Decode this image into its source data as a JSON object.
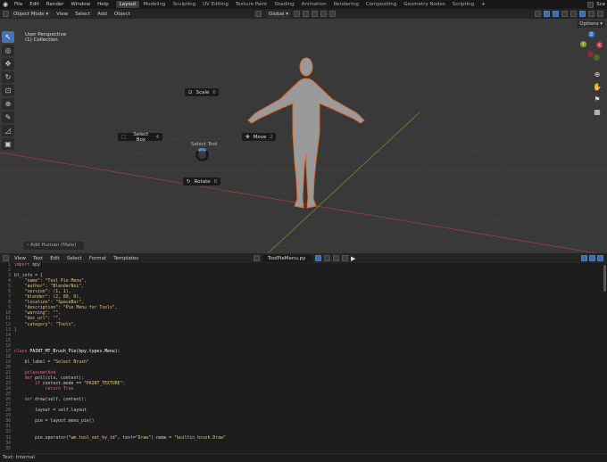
{
  "topbar": {
    "menus": [
      "File",
      "Edit",
      "Render",
      "Window",
      "Help"
    ],
    "workspaces": [
      "Layout",
      "Modeling",
      "Sculpting",
      "UV Editing",
      "Texture Paint",
      "Shading",
      "Animation",
      "Rendering",
      "Compositing",
      "Geometry Nodes",
      "Scripting"
    ],
    "active_workspace": "Layout",
    "add_tab": "+",
    "scene_label": "Sce"
  },
  "viewport_header": {
    "mode": "Object Mode",
    "menus": [
      "View",
      "Select",
      "Add",
      "Object"
    ],
    "transform": "Global",
    "options": "Options"
  },
  "viewport": {
    "title": "User Perspective",
    "collection": "(1) Collection",
    "pie": {
      "title": "Select Tool",
      "scale": {
        "label": "Scale",
        "key": "6"
      },
      "select_box": {
        "label": "Select Box",
        "key": "4"
      },
      "move": {
        "label": "Move",
        "key": "2"
      },
      "rotate": {
        "label": "Rotate",
        "key": "8"
      }
    },
    "operator_panel": "Add Human (Male)",
    "gizmo": {
      "x": "X",
      "y": "Y",
      "z": "Z"
    }
  },
  "editor_header": {
    "menus": [
      "View",
      "Text",
      "Edit",
      "Select",
      "Format",
      "Templates"
    ],
    "filename": "ToolPieMenu.py"
  },
  "code_lines": [
    [
      {
        "t": "import",
        "c": "kw"
      },
      {
        "t": " bpy",
        "c": ""
      }
    ],
    [],
    [
      {
        "t": "bl_info = {",
        "c": ""
      }
    ],
    [
      {
        "t": "    ",
        "c": ""
      },
      {
        "t": "\"name\": \"Tool Pie Menu\",",
        "c": "str"
      }
    ],
    [
      {
        "t": "    ",
        "c": ""
      },
      {
        "t": "\"author\": \"BlenderNoi\",",
        "c": "str"
      }
    ],
    [
      {
        "t": "    ",
        "c": ""
      },
      {
        "t": "\"version\": (1, 1),",
        "c": "str"
      }
    ],
    [
      {
        "t": "    ",
        "c": ""
      },
      {
        "t": "\"blender\": (2, 80, 0),",
        "c": "str"
      }
    ],
    [
      {
        "t": "    ",
        "c": ""
      },
      {
        "t": "\"location\": \"SpaceBar\",",
        "c": "str"
      }
    ],
    [
      {
        "t": "    ",
        "c": ""
      },
      {
        "t": "\"description\": \"Pie Menu for Tools\",",
        "c": "str"
      }
    ],
    [
      {
        "t": "    ",
        "c": ""
      },
      {
        "t": "\"warning\": \"\",",
        "c": "str"
      }
    ],
    [
      {
        "t": "    ",
        "c": ""
      },
      {
        "t": "\"doc_url\": \"\",",
        "c": "str"
      }
    ],
    [
      {
        "t": "    ",
        "c": ""
      },
      {
        "t": "\"category\": \"Tools\",",
        "c": "str"
      }
    ],
    [
      {
        "t": "}",
        "c": "kw"
      }
    ],
    [],
    [],
    [],
    [
      {
        "t": "class",
        "c": "kw"
      },
      {
        "t": " PAINT_MT_Brush_Pie(bpy.types.Menu):",
        "c": "fn"
      }
    ],
    [],
    [
      {
        "t": "    bl_label = ",
        "c": ""
      },
      {
        "t": "\"Select Brush\"",
        "c": "str"
      }
    ],
    [],
    [
      {
        "t": "    @classmethod",
        "c": "kw"
      }
    ],
    [
      {
        "t": "    ",
        "c": ""
      },
      {
        "t": "def",
        "c": "kw"
      },
      {
        "t": " poll(cls, context):",
        "c": ""
      }
    ],
    [
      {
        "t": "        ",
        "c": ""
      },
      {
        "t": "if",
        "c": "kw"
      },
      {
        "t": " context.mode == ",
        "c": ""
      },
      {
        "t": "\"PAINT_TEXTURE\"",
        "c": "str"
      },
      {
        "t": ":",
        "c": ""
      }
    ],
    [
      {
        "t": "            ",
        "c": ""
      },
      {
        "t": "return True",
        "c": "kw"
      }
    ],
    [],
    [
      {
        "t": "    ",
        "c": ""
      },
      {
        "t": "def",
        "c": "kw"
      },
      {
        "t": " draw(self, context):",
        "c": ""
      }
    ],
    [],
    [
      {
        "t": "        layout = self.layout",
        "c": ""
      }
    ],
    [],
    [
      {
        "t": "        pie = layout.menu_pie()",
        "c": ""
      }
    ],
    [],
    [],
    [
      {
        "t": "        pie.operator(",
        "c": ""
      },
      {
        "t": "\"wm.tool_set_by_id\"",
        "c": "str"
      },
      {
        "t": ", text=",
        "c": ""
      },
      {
        "t": "\"Draw\"",
        "c": "str"
      },
      {
        "t": ").name = ",
        "c": ""
      },
      {
        "t": "\"builtin_brush.Draw\"",
        "c": "str"
      }
    ],
    [],
    []
  ],
  "statusbar": {
    "text": "Text: Internal"
  }
}
